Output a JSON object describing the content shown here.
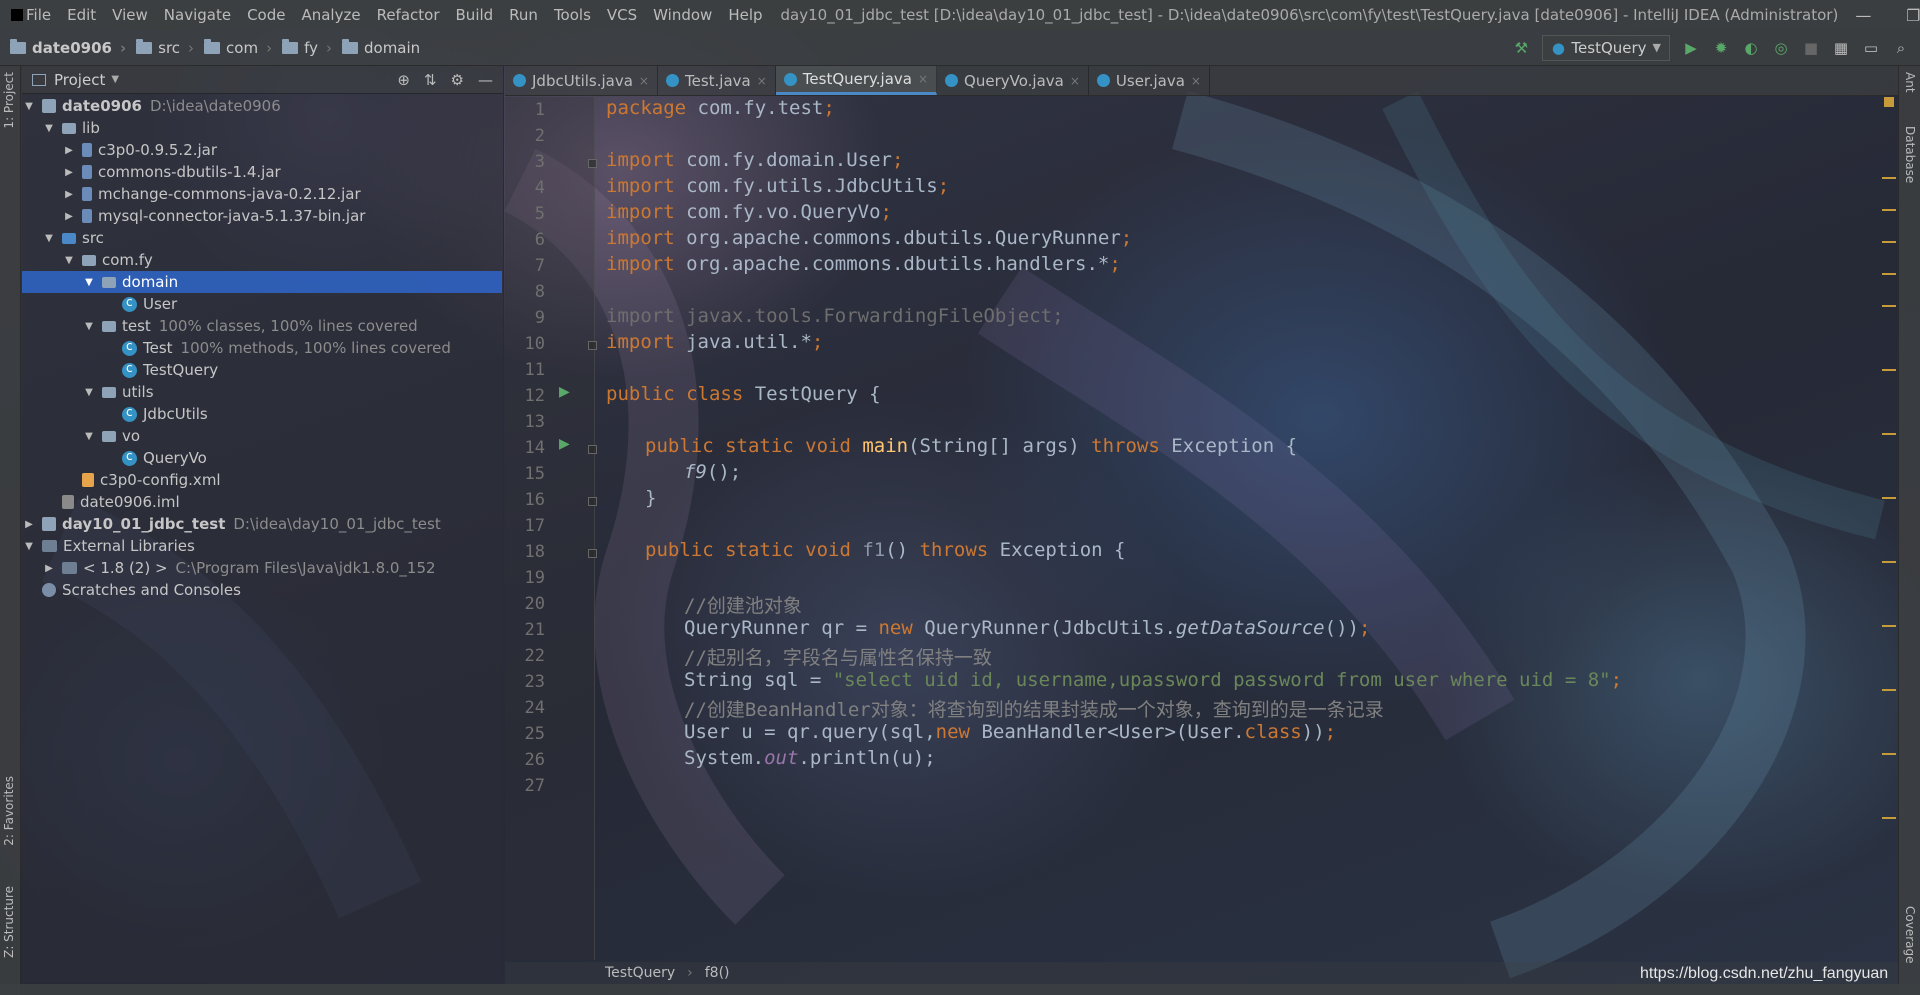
{
  "menubar": {
    "items": [
      "File",
      "Edit",
      "View",
      "Navigate",
      "Code",
      "Analyze",
      "Refactor",
      "Build",
      "Run",
      "Tools",
      "VCS",
      "Window",
      "Help"
    ],
    "title": "day10_01_jdbc_test [D:\\idea\\day10_01_jdbc_test] - D:\\idea\\date0906\\src\\com\\fy\\test\\TestQuery.java [date0906] - IntelliJ IDEA (Administrator)",
    "window_controls": [
      "—",
      "❐",
      "✕"
    ]
  },
  "navbar": {
    "breadcrumbs": [
      "date0906",
      "src",
      "com",
      "fy",
      "domain"
    ],
    "run_config": "TestQuery"
  },
  "left_strip": {
    "project_tab": "1: Project",
    "favorites_tab": "2: Favorites",
    "structure_tab": "Z: Structure"
  },
  "right_strip": {
    "ant_tab": "Ant",
    "database_tab": "Database",
    "coverage_tab": "Coverage"
  },
  "project_panel": {
    "header_label": "Project",
    "tree": [
      {
        "name": "date0906",
        "path": "D:\\idea\\date0906",
        "bold": true
      },
      {
        "name": "lib"
      },
      {
        "name": "c3p0-0.9.5.2.jar"
      },
      {
        "name": "commons-dbutils-1.4.jar"
      },
      {
        "name": "mchange-commons-java-0.2.12.jar"
      },
      {
        "name": "mysql-connector-java-5.1.37-bin.jar"
      },
      {
        "name": "src"
      },
      {
        "name": "com.fy"
      },
      {
        "name": "domain"
      },
      {
        "name": "User"
      },
      {
        "name": "test",
        "coverage": "100% classes, 100% lines covered"
      },
      {
        "name": "Test",
        "coverage": "100% methods, 100% lines covered"
      },
      {
        "name": "TestQuery"
      },
      {
        "name": "utils"
      },
      {
        "name": "JdbcUtils"
      },
      {
        "name": "vo"
      },
      {
        "name": "QueryVo"
      },
      {
        "name": "c3p0-config.xml"
      },
      {
        "name": "date0906.iml"
      },
      {
        "name": "day10_01_jdbc_test",
        "path": "D:\\idea\\day10_01_jdbc_test",
        "bold": true
      },
      {
        "name": "External Libraries"
      },
      {
        "name": "< 1.8 (2) >",
        "path": "C:\\Program Files\\Java\\jdk1.8.0_152"
      },
      {
        "name": "Scratches and Consoles"
      }
    ]
  },
  "tabs": [
    {
      "label": "JdbcUtils.java"
    },
    {
      "label": "Test.java"
    },
    {
      "label": "TestQuery.java",
      "active": true
    },
    {
      "label": "QueryVo.java"
    },
    {
      "label": "User.java"
    }
  ],
  "editor": {
    "line_numbers": [
      "1",
      "2",
      "3",
      "4",
      "5",
      "6",
      "7",
      "8",
      "9",
      "10",
      "11",
      "12",
      "13",
      "14",
      "15",
      "16",
      "17",
      "18",
      "19",
      "20",
      "21",
      "22",
      "23",
      "24",
      "25",
      "26",
      "27"
    ],
    "tokens": {
      "package_kw": "package",
      "package_name": " com.fy.test",
      "import_kw": "import",
      "imp1": " com.fy.domain.User",
      "imp2": " com.fy.utils.JdbcUtils",
      "imp3": " com.fy.vo.QueryVo",
      "imp4": " org.apache.commons.dbutils.QueryRunner",
      "imp5": " org.apache.commons.dbutils.handlers.*",
      "imp9": "import javax.tools.ForwardingFileObject;",
      "imp10": " java.util.*",
      "semi": ";",
      "public_class": "public class ",
      "class_name": "TestQuery {",
      "psv": "public static void ",
      "main": "main",
      "main_args": "(String[] args) ",
      "throws": "throws",
      "exc_open": " Exception {",
      "f9": "f9",
      "call_end": "();",
      "close_brace": "}",
      "f1": "f1",
      "f1_params": "() ",
      "c20": "//创建池对象",
      "l21a": "QueryRunner qr = ",
      "new_kw": "new",
      "l21b": " QueryRunner(JdbcUtils.",
      "getds": "getDataSource",
      "l21c": "())",
      "c22": "//起别名，字段名与属性名保持一致",
      "l23a": "String sql = ",
      "sql": "\"select uid id, username,upassword password from user where uid = 8\"",
      "c24": "//创建BeanHandler对象：将查询到的结果封装成一个对象，查询到的是一条记录",
      "l25a": "User u = qr.query(sql,",
      "l25b": " BeanHandler<User>(User.",
      "class_kw": "class",
      "l25c": "))",
      "l26a": "System.",
      "out": "out",
      "l26b": ".println(u);"
    }
  },
  "editor_breadcrumbs": [
    "TestQuery",
    "f8()"
  ],
  "watermark": "https://blog.csdn.net/zhu_fangyuan"
}
